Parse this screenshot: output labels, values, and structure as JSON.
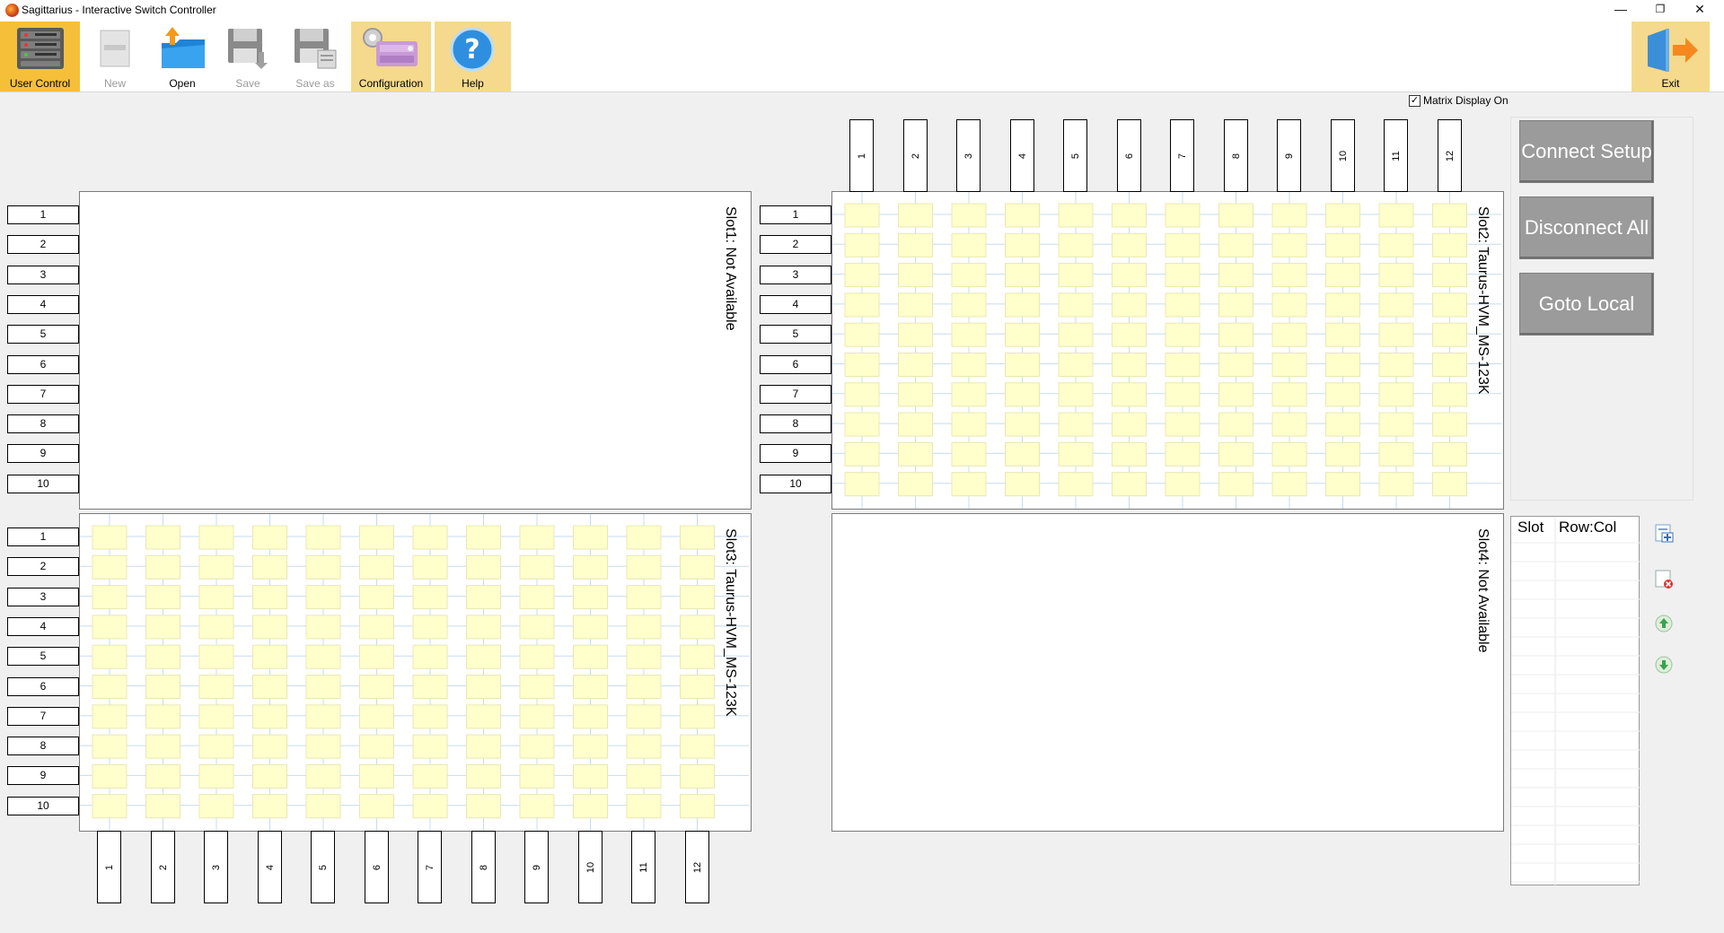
{
  "window": {
    "title": "Sagittarius - Interactive Switch Controller",
    "controls": {
      "minimize": "—",
      "restore": "❐",
      "close": "✕"
    }
  },
  "toolbar": {
    "user_control": "User Control",
    "new": "New",
    "open": "Open",
    "save": "Save",
    "save_as": "Save as",
    "configuration": "Configuration",
    "help": "Help",
    "exit": "Exit"
  },
  "matrix_display": {
    "label": "Matrix Display On",
    "checked": true
  },
  "buttons": {
    "connect_setup": "Connect Setup",
    "disconnect_all": "Disconnect All",
    "goto_local": "Goto Local"
  },
  "slots": [
    {
      "label": "Slot1: Not Available",
      "available": false
    },
    {
      "label": "Slot2: Taurus-HVM_MS-123K",
      "available": true
    },
    {
      "label": "Slot3: Taurus-HVM_MS-123K",
      "available": true
    },
    {
      "label": "Slot4: Not Available",
      "available": false
    }
  ],
  "rows": [
    "1",
    "2",
    "3",
    "4",
    "5",
    "6",
    "7",
    "8",
    "9",
    "10"
  ],
  "columns": [
    "1",
    "2",
    "3",
    "4",
    "5",
    "6",
    "7",
    "8",
    "9",
    "10",
    "11",
    "12"
  ],
  "connection_list": {
    "col_slot": "Slot",
    "col_rowcol": "Row:Col"
  },
  "colors": {
    "cell_fill": "#ffffcc",
    "cell_border": "#e8e8b0",
    "grid_line": "#c7dcef",
    "active_tool": "#f5bf3a",
    "highlight_tool": "#f5d98c",
    "button_gray": "#9b9b9b"
  }
}
